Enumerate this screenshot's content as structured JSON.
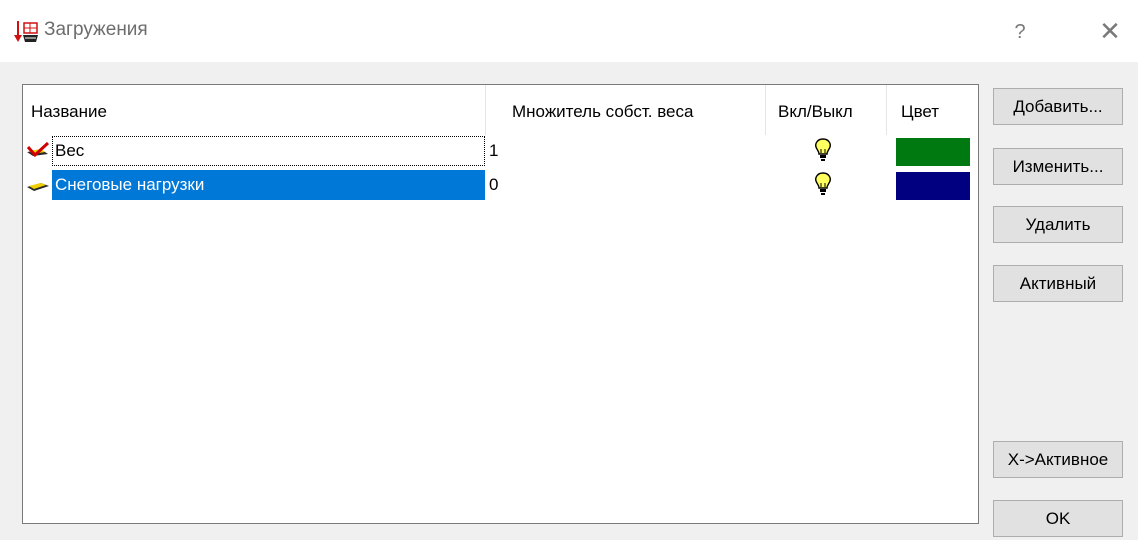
{
  "window": {
    "title": "Загружения",
    "help_label": "?",
    "close_label": "✕"
  },
  "table": {
    "columns": [
      "Название",
      "Множитель собст. веса",
      "Вкл/Выкл",
      "Цвет"
    ],
    "rows": [
      {
        "name": "Вес",
        "multiplier": "1",
        "state_icon": "lightbulb-icon",
        "color": "#007a10",
        "row_icon": "checked-load-icon",
        "focused": true,
        "selected": false
      },
      {
        "name": "Снеговые нагрузки",
        "multiplier": "0",
        "state_icon": "lightbulb-icon",
        "color": "#000080",
        "row_icon": "load-plate-icon",
        "focused": false,
        "selected": true
      }
    ]
  },
  "buttons": {
    "add": "Добавить...",
    "edit": "Изменить...",
    "delete": "Удалить",
    "active": "Активный",
    "x_active": "X->Активное",
    "ok": "OK"
  }
}
